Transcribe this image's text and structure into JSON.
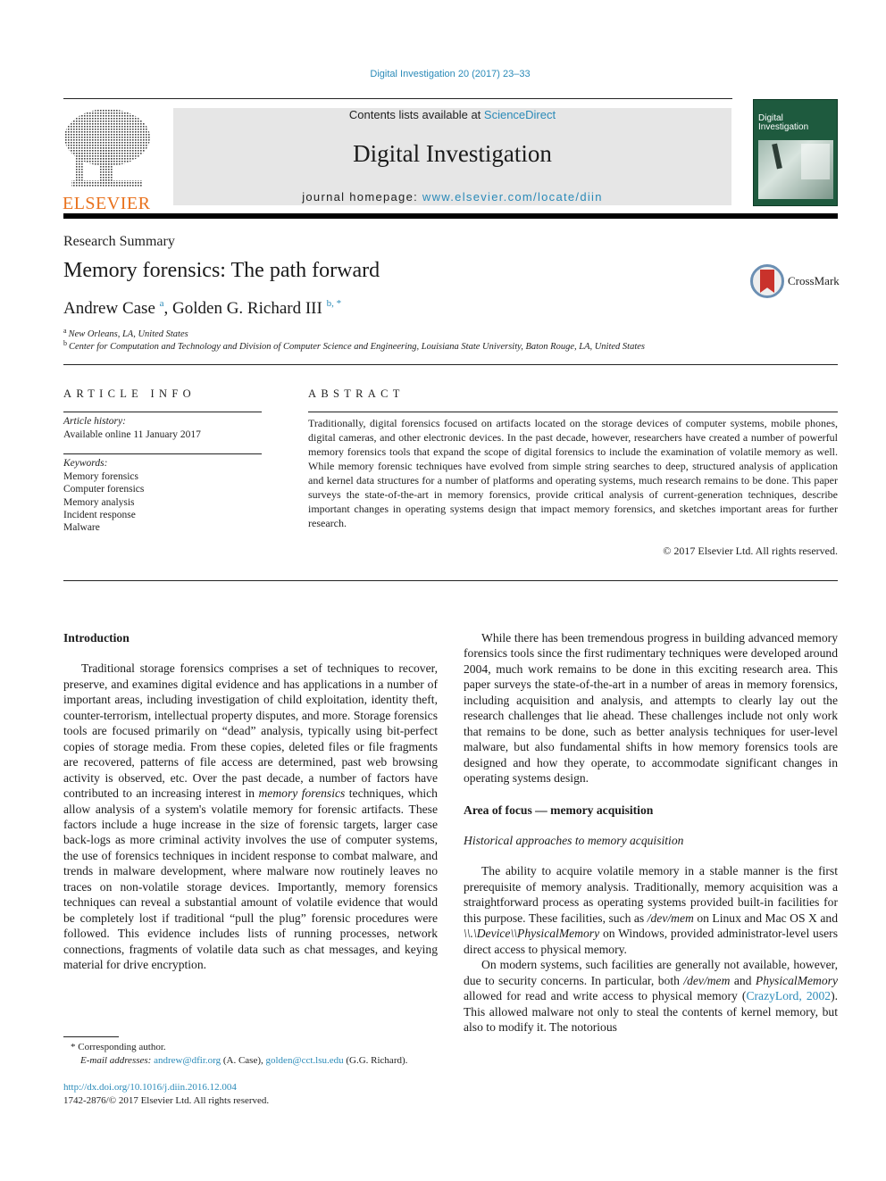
{
  "header": {
    "journal_ref": "Digital Investigation 20 (2017) 23–33",
    "contents_prefix": "Contents lists available at ",
    "contents_link": "ScienceDirect",
    "journal_title": "Digital Investigation",
    "homepage_prefix": "journal homepage: ",
    "homepage_link": "www.elsevier.com/locate/diin",
    "publisher_logo_text": "ELSEVIER",
    "cover_title_line1": "Digital",
    "cover_title_line2": "Investigation"
  },
  "article": {
    "type": "Research Summary",
    "title": "Memory forensics: The path forward",
    "crossmark_label": "CrossMark",
    "authors": [
      {
        "name": "Andrew Case",
        "sup": "a"
      },
      {
        "name": "Golden G. Richard III",
        "sup": "b, *"
      }
    ],
    "affiliations": [
      {
        "mark": "a",
        "text": "New Orleans, LA, United States"
      },
      {
        "mark": "b",
        "text": "Center for Computation and Technology and Division of Computer Science and Engineering, Louisiana State University, Baton Rouge, LA, United States"
      }
    ]
  },
  "article_info": {
    "heading": "ARTICLE INFO",
    "history_label": "Article history:",
    "history_value": "Available online 11 January 2017",
    "keywords_label": "Keywords:",
    "keywords": [
      "Memory forensics",
      "Computer forensics",
      "Memory analysis",
      "Incident response",
      "Malware"
    ]
  },
  "abstract": {
    "heading": "ABSTRACT",
    "text": "Traditionally, digital forensics focused on artifacts located on the storage devices of computer systems, mobile phones, digital cameras, and other electronic devices. In the past decade, however, researchers have created a number of powerful memory forensics tools that expand the scope of digital forensics to include the examination of volatile memory as well. While memory forensic techniques have evolved from simple string searches to deep, structured analysis of application and kernel data structures for a number of platforms and operating systems, much research remains to be done. This paper surveys the state-of-the-art in memory forensics, provide critical analysis of current-generation techniques, describe important changes in operating systems design that impact memory forensics, and sketches important areas for further research.",
    "copyright": "© 2017 Elsevier Ltd. All rights reserved."
  },
  "body": {
    "intro_heading": "Introduction",
    "intro_p1_a": "Traditional storage forensics comprises a set of techniques to recover, preserve, and examines digital evidence and has applications in a number of important areas, including investigation of child exploitation, identity theft, counter-terrorism, intellectual property disputes, and more. Storage forensics tools are focused primarily on “dead” analysis, typically using bit-perfect copies of storage media. From these copies, deleted files or file fragments are recovered, patterns of file access are determined, past web browsing activity is observed, etc. Over the past decade, a number of factors have contributed to an increasing interest in ",
    "intro_p1_em": "memory forensics",
    "intro_p1_b": " techniques, which allow analysis of a system's volatile memory for forensic artifacts. These factors include a huge increase in the size of forensic targets, larger case back-logs as more criminal activity involves the use of computer systems, the use of forensics techniques in incident response to combat malware, and trends in malware development, where malware now routinely leaves no traces on non-volatile storage devices. Importantly, memory forensics techniques can reveal a substantial amount of volatile evidence that would be completely lost if traditional “pull the plug” forensic procedures were followed. This evidence includes lists of running processes, network connections, fragments of volatile data such as chat messages, and keying material for drive encryption.",
    "right_p1": "While there has been tremendous progress in building advanced memory forensics tools since the first rudimentary techniques were developed around 2004, much work remains to be done in this exciting research area. This paper surveys the state-of-the-art in a number of areas in memory forensics, including acquisition and analysis, and attempts to clearly lay out the research challenges that lie ahead. These challenges include not only work that remains to be done, such as better analysis techniques for user-level malware, but also fundamental shifts in how memory forensics tools are designed and how they operate, to accommodate significant changes in operating systems design.",
    "section2_heading": "Area of focus — memory acquisition",
    "subsection_heading": "Historical approaches to memory acquisition",
    "right_p2_a": "The ability to acquire volatile memory in a stable manner is the first prerequisite of memory analysis. Traditionally, memory acquisition was a straightforward process as operating systems provided built-in facilities for this purpose. These facilities, such as ",
    "right_p2_em1": "/dev/mem",
    "right_p2_b": " on Linux and Mac OS X and ",
    "right_p2_em2": "\\\\.\\Device\\\\PhysicalMemory",
    "right_p2_c": " on Windows, provided administrator-level users direct access to physical memory.",
    "right_p3_a": "On modern systems, such facilities are generally not available, however, due to security concerns. In particular, both ",
    "right_p3_em1": "/dev/mem",
    "right_p3_b": " and ",
    "right_p3_em2": "PhysicalMemory",
    "right_p3_c": " allowed for read and write access to physical memory (",
    "right_p3_link": "CrazyLord, 2002",
    "right_p3_d": "). This allowed malware not only to steal the contents of kernel memory, but also to modify it. The notorious"
  },
  "footnotes": {
    "corresponding": "* Corresponding author.",
    "email_label": "E-mail addresses:",
    "email1": "andrew@dfir.org",
    "email1_name": " (A. Case), ",
    "email2": "golden@cct.lsu.edu",
    "email2_name": " (G.G. Richard).",
    "doi": "http://dx.doi.org/10.1016/j.diin.2016.12.004",
    "issn_copyright": "1742-2876/© 2017 Elsevier Ltd. All rights reserved."
  }
}
